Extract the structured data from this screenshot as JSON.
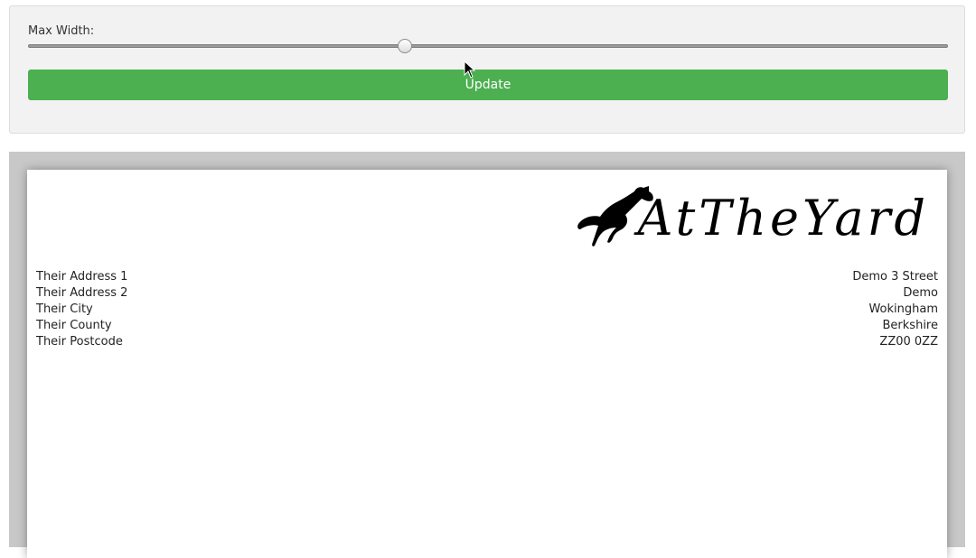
{
  "controls": {
    "slider_label": "Max Width:",
    "slider_value_fraction": 0.41,
    "update_label": "Update",
    "accent_color": "#4caf50"
  },
  "letter": {
    "logo_text": "AtTheYard",
    "logo_icon": "jumping-horse-icon",
    "recipient_address": [
      "Their Address 1",
      "Their Address 2",
      "Their City",
      "Their County",
      "Their Postcode"
    ],
    "sender_address": [
      "Demo 3 Street",
      "Demo",
      "Wokingham",
      "Berkshire",
      "ZZ00 0ZZ"
    ]
  }
}
